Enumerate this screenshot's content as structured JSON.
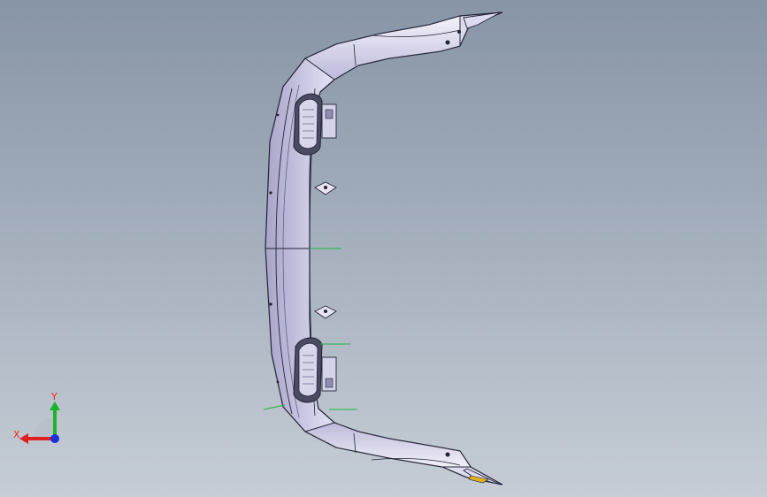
{
  "viewport": {
    "background_top": "#8895a6",
    "background_bottom": "#c6cdd6"
  },
  "model": {
    "part": "front-bumper-grille-frame",
    "body_color": "#e6e4f2",
    "shade_color": "#a9a6c9",
    "edge_color": "#232336",
    "construction_line_color": "#1fb53a",
    "accent_color": "#e0b020"
  },
  "triad": {
    "x_label": "X",
    "y_label": "Y",
    "x_color": "#e0201e",
    "y_color": "#19b52b",
    "z_color": "#1f2fd8",
    "label_color": "#ff2020"
  }
}
